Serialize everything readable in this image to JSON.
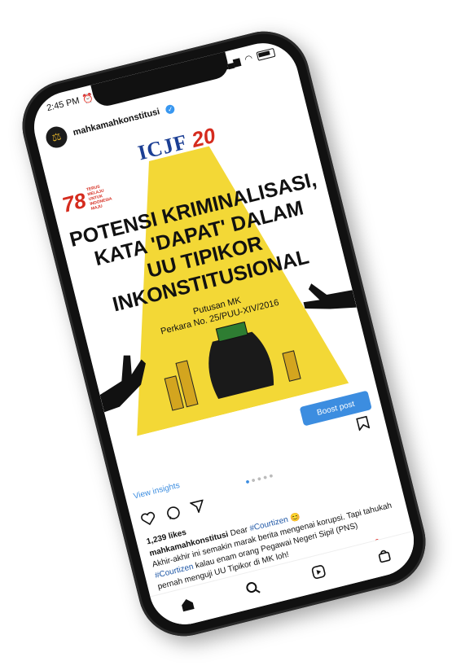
{
  "status": {
    "time": "2:45 PM"
  },
  "post": {
    "username": "mahkamahkonstitusi",
    "brand_main": "ICJF",
    "brand_anniv": "20",
    "anniv_badge": "78",
    "anniv_text": "TERUS MELAJU UNTUK INDONESIA MAJU",
    "headline_lines": [
      "POTENSI KRIMINALISASI,",
      "KATA 'DAPAT' DALAM",
      "UU TIPIKOR",
      "INKONSTITUSIONAL"
    ],
    "sub_lines": [
      "Putusan MK",
      "Perkara No. 25/PUU-XIV/2016"
    ],
    "boost_label": "Boost post",
    "view_insights": "View insights",
    "likes": "1,239 likes",
    "caption_user": "mahkamahkonstitusi",
    "caption_intro": "Dear",
    "caption_tag1": "#Courtizen",
    "caption_line2a": "Akhir-akhir ini semakin marak berita mengenai korupsi. Tapi",
    "caption_line2b": "tahukah",
    "caption_tag2": "#Courtizen",
    "caption_line2c": "kalau enam orang Pegawai Negeri Sipil (PNS)",
    "caption_line3": "pernah menguji UU Tipikor di MK loh!"
  },
  "colors": {
    "accent": "#3c8de0",
    "spotlight": "#f3d836",
    "brand_blue": "#1c3f94",
    "brand_red": "#d52b1e"
  },
  "icons": [
    "heart-icon",
    "comment-icon",
    "share-icon",
    "bookmark-icon",
    "home-icon",
    "search-icon",
    "reels-icon",
    "shop-icon"
  ]
}
